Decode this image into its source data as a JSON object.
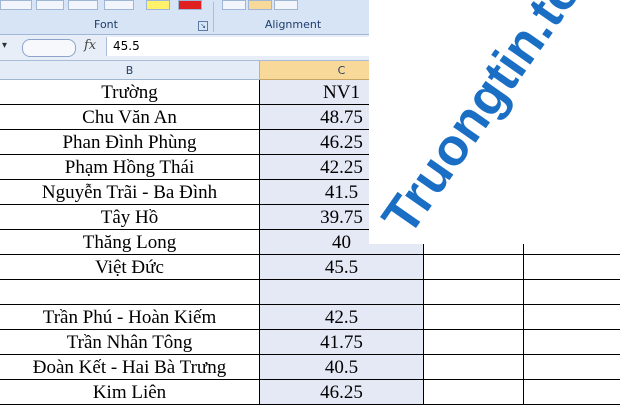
{
  "ribbon": {
    "groups": [
      {
        "label": "Font"
      },
      {
        "label": "Alignment"
      }
    ]
  },
  "formula_bar": {
    "fx_label": "fx",
    "value": "45.5"
  },
  "columns": [
    {
      "label": "B"
    },
    {
      "label": "C"
    }
  ],
  "rows": [
    {
      "school": "Trường",
      "nv1": "NV1"
    },
    {
      "school": "Chu Văn An",
      "nv1": "48.75"
    },
    {
      "school": "Phan Đình Phùng",
      "nv1": "46.25"
    },
    {
      "school": "Phạm Hồng Thái",
      "nv1": "42.25"
    },
    {
      "school": "Nguyễn Trãi - Ba Đình",
      "nv1": "41.5"
    },
    {
      "school": "Tây Hồ",
      "nv1": "39.75"
    },
    {
      "school": "Thăng Long",
      "nv1": "40"
    },
    {
      "school": "Việt Đức",
      "nv1": "45.5"
    },
    {
      "school": "",
      "nv1": ""
    },
    {
      "school": "Trần Phú - Hoàn Kiếm",
      "nv1": "42.5"
    },
    {
      "school": "Trần Nhân Tông",
      "nv1": "41.75"
    },
    {
      "school": "Đoàn Kết - Hai Bà Trưng",
      "nv1": "40.5"
    },
    {
      "school": "Kim Liên",
      "nv1": "46.25"
    }
  ],
  "watermark": {
    "text": "Truongtin.top",
    "color": "#1a6fc4"
  }
}
